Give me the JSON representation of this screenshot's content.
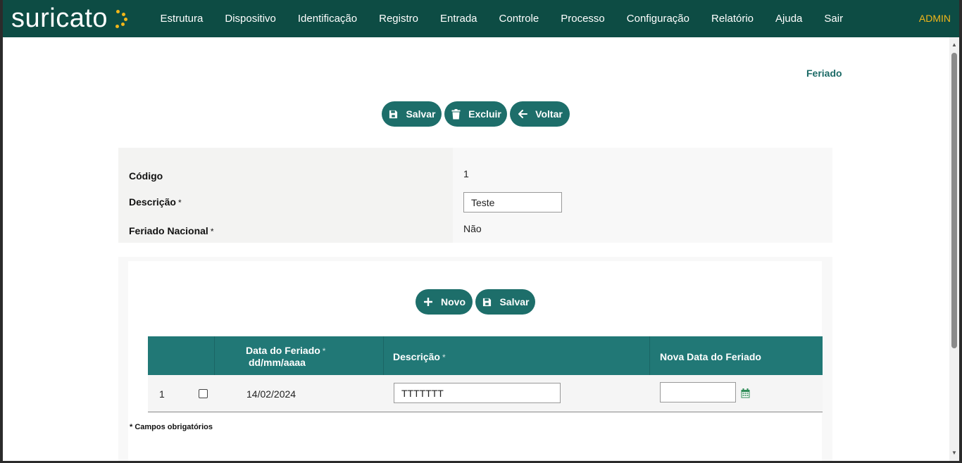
{
  "app": {
    "logo_text": "suricato",
    "accent": "#f2b619",
    "brand_color": "#0d4c44"
  },
  "nav": {
    "items": [
      "Estrutura",
      "Dispositivo",
      "Identificação",
      "Registro",
      "Entrada",
      "Controle",
      "Processo",
      "Configuração",
      "Relatório",
      "Ajuda",
      "Sair"
    ],
    "user": "ADMIN"
  },
  "page": {
    "title": "Feriado"
  },
  "toolbar": {
    "save_label": "Salvar",
    "delete_label": "Excluir",
    "back_label": "Voltar"
  },
  "form": {
    "code_label": "Código",
    "code_value": "1",
    "description_label": "Descrição",
    "description_value": "Teste",
    "national_label": "Feriado Nacional",
    "national_value": "Não",
    "required_mark": "*"
  },
  "subform": {
    "new_label": "Novo",
    "save_label": "Salvar",
    "columns": {
      "date": "Data do Feriado",
      "date_format": "dd/mm/aaaa",
      "description": "Descrição",
      "new_date": "Nova Data do Feriado"
    },
    "rows": [
      {
        "index": "1",
        "checked": false,
        "date": "14/02/2024",
        "description": "TTTTTTT",
        "new_date": ""
      }
    ],
    "required_note": "* Campos obrigatórios"
  }
}
